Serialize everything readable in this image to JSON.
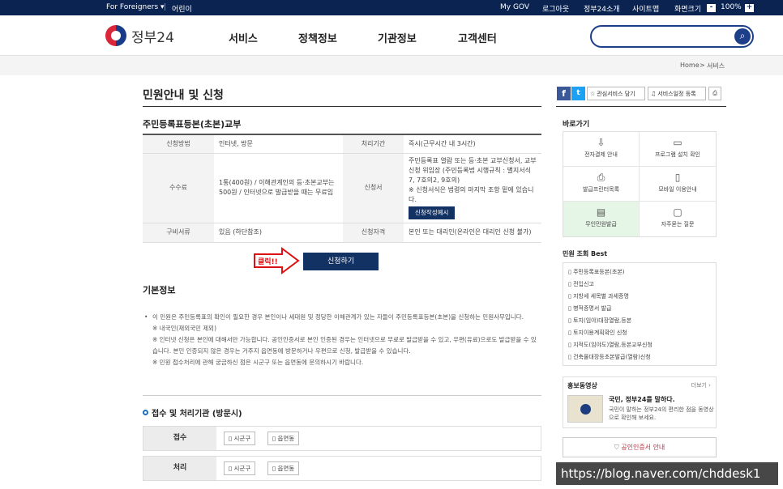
{
  "topbar": {
    "foreigners": "For Foreigners ▾",
    "kids": "어린이",
    "mygov": "My GOV",
    "logout": "로그아웃",
    "about": "정부24소개",
    "sitemap": "사이트맵",
    "screen_size": "화면크기",
    "zoom": "100%",
    "minus": "-",
    "plus": "+"
  },
  "header": {
    "logo_text": "정부24",
    "nav": [
      "서비스",
      "정책정보",
      "기관정보",
      "고객센터"
    ],
    "search_placeholder": ""
  },
  "breadcrumb": {
    "home": "Home",
    "sep": ">",
    "current": "서비스"
  },
  "page": {
    "title": "민원안내 및 신청",
    "fav_label": "관심서비스 담기",
    "alert_label": "서비스일정 등록",
    "subtitle": "주민등록표등본(초본)교부"
  },
  "info": {
    "r1": {
      "h1": "신청방법",
      "v1": "인터넷, 방문",
      "h2": "처리기간",
      "v2": "즉시(근무시간 내 3시간)"
    },
    "r2": {
      "h1": "수수료",
      "v1": "1통(400원) / 이해관계인의 등·초본교부는 500원 / 인터넷으로 발급받을 때는 무료임",
      "h2": "신청서",
      "v2a": "주민등록표 열람 또는 등·초본 교부신청서, 교부신청 위임장 (주민등록법 시행규칙 : 별지서식 7, 7호의2, 9호의)",
      "v2b": "※ 신청서식은 법령의 마지막 조항 밑에 있습니다.",
      "sample_btn": "신청작성예시"
    },
    "r3": {
      "h1": "구비서류",
      "v1": "있음 (하단참조)",
      "h2": "신청자격",
      "v2": "본인 또는 대리인(온라인은 대리인 신청 불가)"
    }
  },
  "apply": {
    "label": "신청하기",
    "click_note": "클릭!!"
  },
  "basic": {
    "title": "기본정보",
    "lines": [
      "이 민원은 주민등록표의 확인이 필요한 경우 본인이나 세대원 및 정당한 이해관계가 있는 자들이 주민등록표등본(초본)을 신청하는 민원사무입니다.",
      "※ 내국인(재외국민 제외)",
      "※ 인터넷 신청은 본인에 대해서만 가능합니다. 공인인증서로 본인 인증된 경우는 인터넷으로 무료로 발급받을 수 있고, 우편(유료)으로도 발급받을 수 있습니다. 본인 인증되지 않은 경우는 거주지 읍면동에 방문하거나 우편으로 신청, 발급받을 수 있습니다.",
      "※ 민원 접수처리에 관해 궁금하신 점은 시군구 또는 읍면동에 문의하시기 바랍니다."
    ]
  },
  "office": {
    "title": "접수 및 처리기관 (방문시)",
    "rows": [
      {
        "label": "접수",
        "tags": [
          "시군구",
          "읍면동"
        ]
      },
      {
        "label": "처리",
        "tags": [
          "시군구",
          "읍면동"
        ]
      }
    ]
  },
  "right": {
    "quick_title": "바로가기",
    "quick": [
      {
        "label": "전자결제 안내",
        "icon": "⇩"
      },
      {
        "label": "프로그램 설치 확인",
        "icon": "▭"
      },
      {
        "label": "발급프린터목록",
        "icon": "⎙"
      },
      {
        "label": "모바일 이용안내",
        "icon": "▯"
      },
      {
        "label": "무인민원발급",
        "icon": "▤"
      },
      {
        "label": "자주묻는 질문",
        "icon": "▢"
      }
    ],
    "best_title": "민원 조회 Best",
    "best": [
      "주민등록표등본(초본)",
      "전입신고",
      "지방세 세목별 과세증명",
      "병적증명서 발급",
      "토지(임야)대장열람,등본",
      "토지이용계획확인 신청",
      "지적도(임야도)열람,등본교부신청",
      "건축물대장등초본발급(열람)신청"
    ],
    "promo_title": "홍보동영상",
    "promo_more": "더보기 ›",
    "promo_head": "국민, 정부24를 말하다.",
    "promo_desc": "국민이 말하는 정부24의 편리한 점을 동영상으로 확인해 보세요.",
    "cert_label": "공인인증서 안내"
  },
  "watermark": "https://blog.naver.com/chddesk1"
}
